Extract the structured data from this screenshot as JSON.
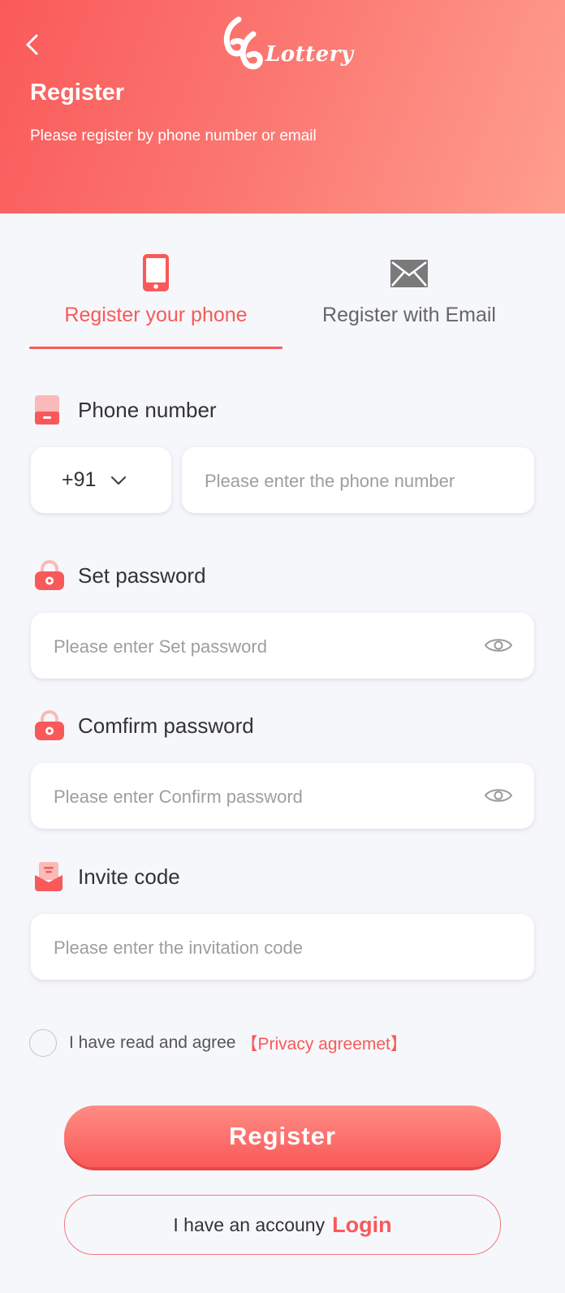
{
  "header": {
    "logo_text": "Lottery",
    "logo_digits": "66",
    "title": "Register",
    "subtitle": "Please  register by phone number or email"
  },
  "tabs": [
    {
      "label": "Register your phone",
      "icon": "phone-icon",
      "active": true
    },
    {
      "label": "Register with Email",
      "icon": "mail-icon",
      "active": false
    }
  ],
  "fields": {
    "phone": {
      "label": "Phone number",
      "country_code": "+91",
      "placeholder": "Please enter the phone number"
    },
    "password": {
      "label": "Set password",
      "placeholder": "Please enter Set password"
    },
    "confirm_password": {
      "label": "Comfirm password",
      "placeholder": "Please enter Confirm password"
    },
    "invite": {
      "label": "Invite code",
      "placeholder": "Please enter the invitation code"
    }
  },
  "agreement": {
    "text": "I have read and agree",
    "link": "【Privacy agreemet】",
    "checked": false
  },
  "actions": {
    "register_label": "Register",
    "login_prefix": "I have an accouny",
    "login_label": "Login"
  },
  "colors": {
    "accent": "#f95959",
    "background": "#f6f7fb"
  }
}
